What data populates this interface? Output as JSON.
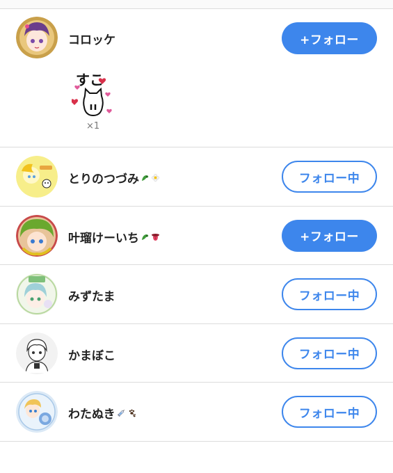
{
  "users": [
    {
      "name": "コロッケ",
      "button": "+フォロー",
      "state": "follow",
      "avatar": "pink-purple-hair-avatar-icon"
    },
    {
      "name": "とりのつづみ",
      "button": "フォロー中",
      "state": "following",
      "avatar": "yellow-character-avatar-icon"
    },
    {
      "name": "叶瑠けーいち",
      "button": "+フォロー",
      "state": "follow",
      "avatar": "green-hair-avatar-icon"
    },
    {
      "name": "みずたま",
      "button": "フォロー中",
      "state": "following",
      "avatar": "green-frame-avatar-icon"
    },
    {
      "name": "かまぼこ",
      "button": "フォロー中",
      "state": "following",
      "avatar": "monochrome-sketch-avatar-icon"
    },
    {
      "name": "わたぬき",
      "button": "フォロー中",
      "state": "following",
      "avatar": "blue-circle-avatar-icon"
    }
  ],
  "reaction": {
    "stamp_text": "すこ",
    "count": "×1",
    "icon": "cat-hearts-stamp-icon"
  },
  "colors": {
    "accent": "#3d86ec",
    "divider": "#dcdcdc",
    "text": "#222222"
  }
}
